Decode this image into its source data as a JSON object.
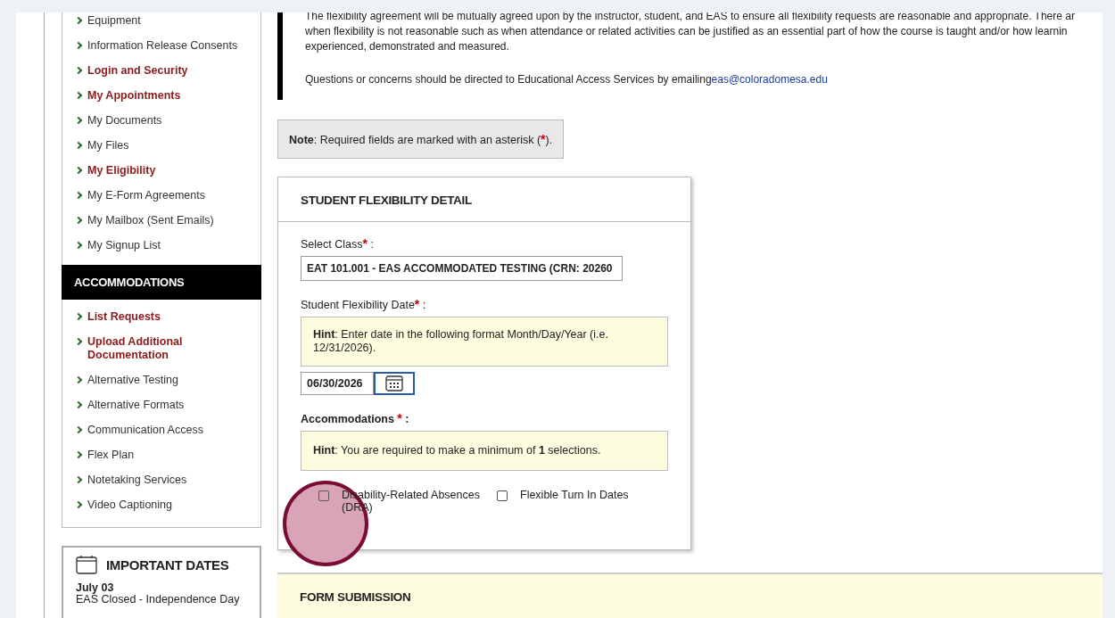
{
  "sidebar": {
    "items": [
      {
        "label": "Equipment",
        "emphasized": false
      },
      {
        "label": "Information Release Consents",
        "emphasized": false
      },
      {
        "label": "Login and Security",
        "emphasized": true
      },
      {
        "label": "My Appointments",
        "emphasized": true
      },
      {
        "label": "My Documents",
        "emphasized": false
      },
      {
        "label": "My Files",
        "emphasized": false
      },
      {
        "label": "My Eligibility",
        "emphasized": true
      },
      {
        "label": "My E-Form Agreements",
        "emphasized": false
      },
      {
        "label": "My Mailbox (Sent Emails)",
        "emphasized": false
      },
      {
        "label": "My Signup List",
        "emphasized": false
      }
    ],
    "section_title": "ACCOMMODATIONS",
    "accommodation_items": [
      {
        "label": "List Requests",
        "emphasized": true
      },
      {
        "label": "Upload Additional Documentation",
        "emphasized": true
      },
      {
        "label": "Alternative Testing",
        "emphasized": false
      },
      {
        "label": "Alternative Formats",
        "emphasized": false
      },
      {
        "label": "Communication Access",
        "emphasized": false
      },
      {
        "label": "Flex Plan",
        "emphasized": false
      },
      {
        "label": "Notetaking Services",
        "emphasized": false
      },
      {
        "label": "Video Captioning",
        "emphasized": false
      }
    ],
    "important_dates": {
      "title": "IMPORTANT DATES",
      "entries": [
        {
          "date": "July 03",
          "event": "EAS Closed - Independence Day"
        }
      ]
    }
  },
  "intro": {
    "lines": [
      "The flexibility agreement will be mutually agreed upon by the instructor, student, and EAS to ensure all flexibility requests are reasonable and appropriate. There ar",
      "when flexibility is not reasonable such as when attendance or related activities can be justified as an essential part of how the course is taught and/or how learnin",
      "experienced, demonstrated and measured."
    ],
    "contact_text": "Questions or concerns should be directed to Educational Access Services by emailing",
    "contact_email": "eas@coloradomesa.edu"
  },
  "note": {
    "text": "**Note**: Required fields are marked with an asterisk (",
    "asterisk": "*",
    "end": ")."
  },
  "detail_card": {
    "title": "STUDENT FLEXIBILITY DETAIL",
    "class_label": "Select Class",
    "class_value": "EAT 101.001 - EAS ACCOMMODATED TESTING (CRN: 20260",
    "date_label": "Student Flexibility Date",
    "date_hint": "**Hint**: Enter date in the following format Month/Day/Year (i.e. 12/31/2026).",
    "date_value": "06/30/2026",
    "accommodations_label": "Accommodations",
    "accommodations_hint": "**Hint**: You are required to make a minimum of **1** selections.",
    "options": [
      {
        "label": "Disability-Related Absences (DRA)",
        "checked": false
      },
      {
        "label": "Flexible Turn In Dates",
        "checked": false
      }
    ],
    "required_mark": "*",
    "colon": ":"
  },
  "form_submission": {
    "title": "FORM SUBMISSION"
  }
}
